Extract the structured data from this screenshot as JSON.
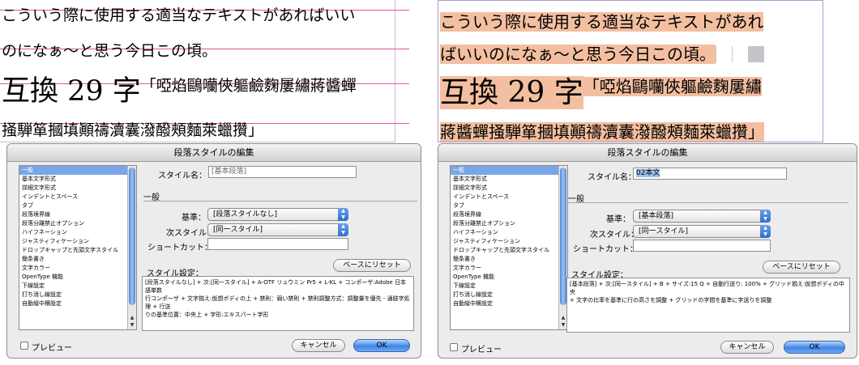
{
  "sample_text": {
    "line1": "こういう際に使用する適当なテキストがあればいい",
    "line2": "のになぁ～と思う今日この頃。",
    "line3_big": "互換 29 字",
    "line3_small": "「啞焰鷗囒俠軀鹼麴屢繡蔣醬蟬",
    "line4": "掻騨箪摑填顚禱瀆囊潑醱頰麵萊蠟攢」",
    "right_line1": "こういう際に使用する適当なテキストがあれ",
    "right_line2": "ばいいのになぁ～と思う今日この頃。",
    "right_line3_big": "互換 29 字",
    "right_line3_small": "「啞焰鷗囒俠軀鹼麴屢繡",
    "right_line4": "蔣醬蟬掻騨箪摑填顚禱瀆囊潑醱頰麵萊蠟攢」"
  },
  "dialog": {
    "title": "段落スタイルの編集",
    "nav_items": [
      "一般",
      "基本文字形式",
      "詳細文字形式",
      "インデントとスペース",
      "タブ",
      "段落境界線",
      "段落分離禁止オプション",
      "ハイフネーション",
      "ジャスティフィケーション",
      "ドロップキャップと先頭文字スタイル",
      "簡条書き",
      "文字カラー",
      "OpenType 機能",
      "下線設定",
      "打ち消し線設定",
      "自動縦中横設定"
    ],
    "style_name_label": "スタイル名：",
    "section_general": "一般",
    "based_on_label": "基準：",
    "next_style_label": "次スタイル：",
    "shortcut_label": "ショートカット：",
    "reset_button": "ベースにリセット",
    "style_settings_label": "スタイル設定：",
    "preview_label": "プレビュー",
    "cancel_button": "キャンセル",
    "ok_button": "OK"
  },
  "left_dialog": {
    "style_name": "[基本段落]",
    "based_on": "[段落スタイルなし]",
    "next_style": "[同一スタイル]",
    "shortcut": "",
    "settings_lines": [
      "[段落スタイルなし] + 次:[同一スタイル] + A-OTF リュウミン Pr5 + L-KL + コンポーザ:Adobe 日本語単数",
      "行コンポーザ + 文字揃え:仮想ボディの上 + 禁則：弱い禁則 + 禁則調整方式：調整量を優先 - 通肢字処理 + 行送",
      "りの基準位置：中央上 + 字形:エキスパート字形"
    ]
  },
  "right_dialog": {
    "style_name": "02本文",
    "based_on": "[基本段落]",
    "next_style": "[同一スタイル]",
    "shortcut": "",
    "settings_lines": [
      "[基本段落] + 次:[同一スタイル] + B + サイズ:15 Q + 自動行送り: 100% + グリッド揃え:仮想ボディの中央",
      "+ 文字の比率を基準に行の高さを調整 + グリッドの字間を基準に字送りを調整"
    ]
  }
}
